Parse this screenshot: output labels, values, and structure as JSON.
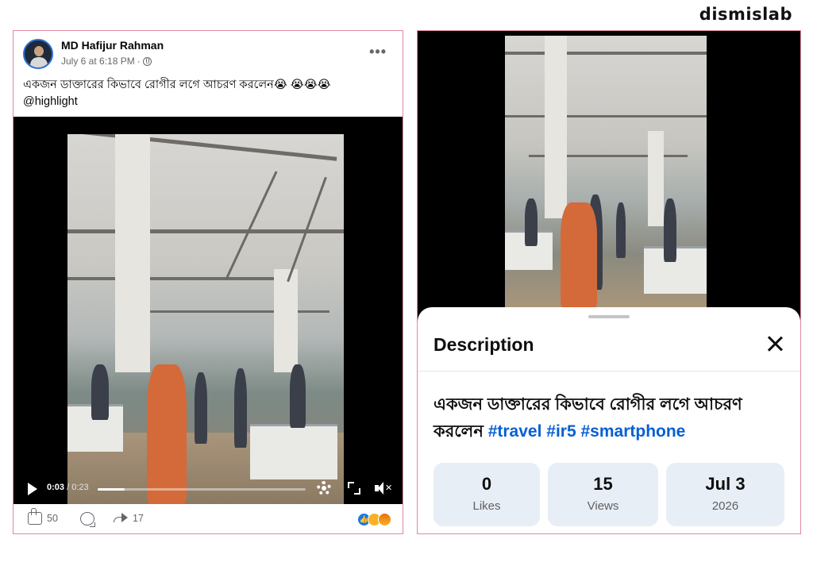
{
  "brand": {
    "logo_text": "dismislab"
  },
  "facebook_post": {
    "author": "MD Hafijur Rahman",
    "date": "July 6 at 6:18 PM",
    "separator": "·",
    "more_label": "•••",
    "caption_line1": "একজন ডাক্তারের কিভাবে রোগীর লগে আচরণ করলেন😭 😭😭😭",
    "caption_line2": "@highlight",
    "video": {
      "current_time": "0:03",
      "duration": "/ 0:23",
      "progress": 0.13
    },
    "actions": {
      "likes": "50",
      "shares": "17"
    },
    "reaction_icons": [
      "like-icon",
      "sad-icon",
      "angry-icon"
    ]
  },
  "short_video": {
    "sheet_title": "Description",
    "description_text": "একজন ডাক্তারের কিভাবে রোগীর লগে আচরণ করলেন ",
    "hashtags": [
      "#travel",
      "#ir5",
      "#smartphone"
    ],
    "stats": [
      {
        "value": "0",
        "label": "Likes"
      },
      {
        "value": "15",
        "label": "Views"
      },
      {
        "value": "Jul 3",
        "label": "2026"
      }
    ]
  },
  "colors": {
    "panel_border": "#e18aa0",
    "facebook_blue": "#1877f2",
    "hashtag_blue": "#065fd4",
    "stat_bg": "#e8eef6"
  }
}
